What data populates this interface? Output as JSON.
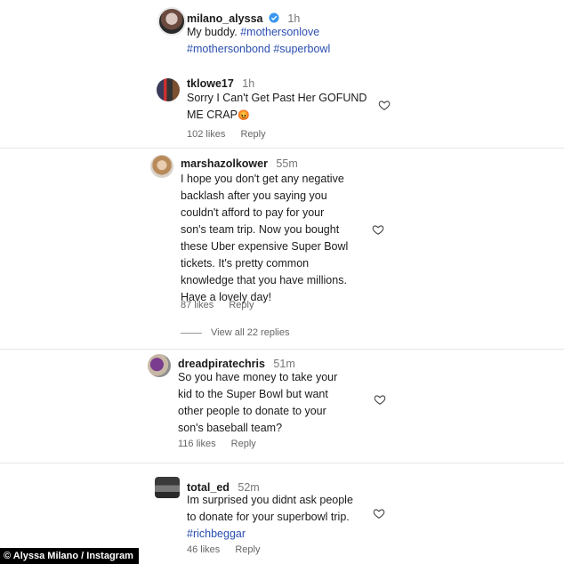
{
  "post": {
    "username": "milano_alyssa",
    "time": "1h",
    "caption_text": "My buddy.",
    "tags": [
      "#mothersonlove",
      "#mothersonbond",
      "#superbowl"
    ]
  },
  "comments": [
    {
      "username": "tklowe17",
      "time": "1h",
      "text_line1": "Sorry I Can't Get Past Her GOFUND",
      "text_line2": "ME CRAP",
      "emoji": "😡",
      "likes": "102 likes",
      "reply": "Reply"
    },
    {
      "username": "marshazolkower",
      "time": "55m",
      "lines": [
        "I hope you don't get any negative",
        "backlash after you saying you",
        "couldn't afford to pay for your",
        "son's team trip. Now you bought",
        "these Uber expensive Super Bowl",
        "tickets. It's pretty common",
        "knowledge that you have millions.",
        "Have a lovely day!"
      ],
      "likes": "87 likes",
      "reply": "Reply",
      "view_replies": "View all 22 replies"
    },
    {
      "username": "dreadpiratechris",
      "time": "51m",
      "lines": [
        "So you have money to take your",
        "kid to the Super Bowl but want",
        "other people to donate to your",
        "son's baseball team?"
      ],
      "likes": "116 likes",
      "reply": "Reply"
    },
    {
      "username": "total_ed",
      "time": "52m",
      "lines": [
        "Im surprised you didnt ask people",
        "to donate for your superbowl trip."
      ],
      "tag": "#richbeggar",
      "likes": "46 likes",
      "reply": "Reply"
    }
  ],
  "credit": "© Alyssa Milano / Instagram",
  "colors": {
    "hashtag": "#2b4fb0",
    "verified": "#3897f0",
    "emoji": "#e0392b"
  }
}
